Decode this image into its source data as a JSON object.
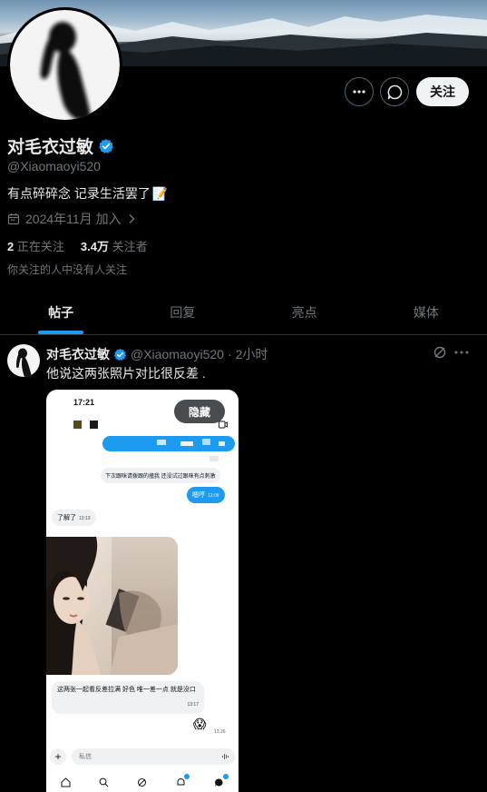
{
  "profile": {
    "name": "对毛衣过敏",
    "handle": "@Xiaomaoyi520",
    "bio": "有点碎碎念 记录生活罢了",
    "bio_emoji": "📝",
    "joined": "2024年11月 加入",
    "following_count": "2",
    "following_label": "正在关注",
    "followers_count": "3.4万",
    "followers_label": "关注者",
    "mutual_note": "你关注的人中没有人关注",
    "follow_label": "关注"
  },
  "tabs": [
    {
      "label": "帖子",
      "active": true
    },
    {
      "label": "回复",
      "active": false
    },
    {
      "label": "亮点",
      "active": false
    },
    {
      "label": "媒体",
      "active": false
    }
  ],
  "post": {
    "author": "对毛衣过敏",
    "handle": "@Xiaomaoyi520",
    "sep": "·",
    "time": "2小时",
    "text": "他说这两张照片对比很反差 .",
    "media": {
      "status_time": "17:21",
      "hide_label": "隐藏",
      "msg_blue_pill": "下次跟咪请拨跟的撞我 还没试过跟咪有点刺激",
      "msg_reply": "嗯哼",
      "msg_reply_time": "13:08",
      "msg_ack": "了解了",
      "msg_ack_time": "13:13",
      "msg_long": "这两张一起看反差拉满 好色 唯一差一点 就是没口",
      "msg_long_time": "13:17",
      "emoji": "😱",
      "emoji_time": "13:26",
      "input_placeholder": "私信"
    }
  },
  "colors": {
    "accent": "#1d9bf0",
    "muted": "#71767b",
    "text": "#e7e9ea",
    "background": "#000000"
  },
  "icons": [
    "more-icon",
    "message-icon",
    "verified-icon",
    "calendar-icon",
    "chevron-right-icon",
    "grok-icon"
  ]
}
